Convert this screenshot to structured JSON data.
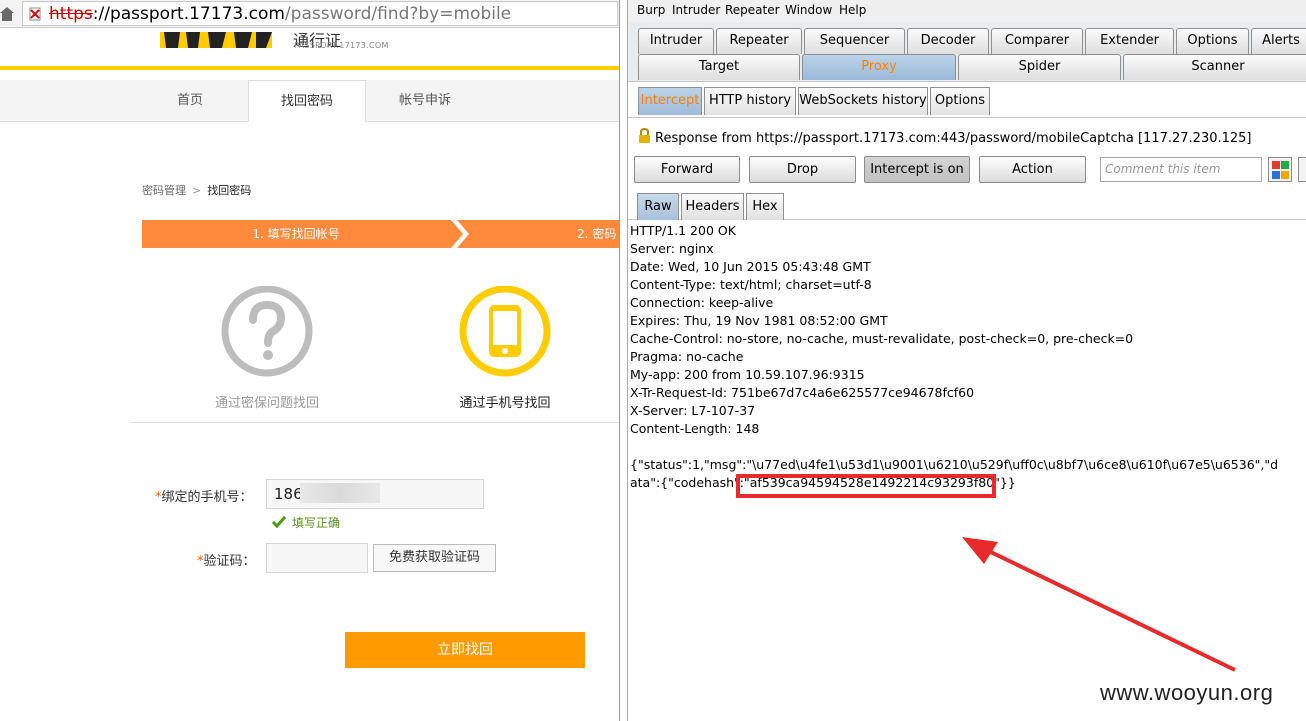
{
  "browser": {
    "url_scheme": "https",
    "url_host": "://passport.17173.com",
    "url_path": "/password/find?by=mobile"
  },
  "site": {
    "logo_title": "通行证",
    "logo_sub": "PASSPORT.17173.COM",
    "nav": [
      "首页",
      "找回密码",
      "帐号申诉"
    ],
    "breadcrumb": {
      "parent": "密码管理",
      "sep": ">",
      "current": "找回密码"
    },
    "steps": [
      "1. 填写找回帐号",
      "2. 密码"
    ],
    "methods": {
      "question": "通过密保问题找回",
      "mobile": "通过手机号找回"
    },
    "form": {
      "phone_label": "绑定的手机号：",
      "phone_value": "186",
      "phone_ok": "填写正确",
      "captcha_label": "验证码：",
      "captcha_button": "免费获取验证码",
      "submit": "立即找回"
    }
  },
  "burp": {
    "menu": [
      "Burp",
      "Intruder",
      "Repeater",
      "Window",
      "Help"
    ],
    "tabs_row1": [
      "Intruder",
      "Repeater",
      "Sequencer",
      "Decoder",
      "Comparer",
      "Extender",
      "Options",
      "Alerts"
    ],
    "tabs_row2": [
      "Target",
      "Proxy",
      "Spider",
      "Scanner"
    ],
    "proxy_tabs": [
      "Intercept",
      "HTTP history",
      "WebSockets history",
      "Options"
    ],
    "response_info": "Response from https://passport.17173.com:443/password/mobileCaptcha   [117.27.230.125]",
    "buttons": {
      "forward": "Forward",
      "drop": "Drop",
      "intercept": "Intercept is on",
      "action": "Action"
    },
    "comment_placeholder": "Comment this item",
    "view_tabs": [
      "Raw",
      "Headers",
      "Hex"
    ],
    "raw_lines": [
      "HTTP/1.1 200 OK",
      "Server: nginx",
      "Date: Wed, 10 Jun 2015 05:43:48 GMT",
      "Content-Type: text/html; charset=utf-8",
      "Connection: keep-alive",
      "Expires: Thu, 19 Nov 1981 08:52:00 GMT",
      "Cache-Control: no-store, no-cache, must-revalidate, post-check=0, pre-check=0",
      "Pragma: no-cache",
      "My-app: 200 from 10.59.107.96:9315",
      "X-Tr-Request-Id: 751be67d7c4a6e625577ce94678fcf60",
      "X-Server: L7-107-37",
      "Content-Length: 148",
      "",
      "{\"status\":1,\"msg\":\"\\u77ed\\u4fe1\\u53d1\\u9001\\u6210\\u529f\\uff0c\\u8bf7\\u6ce8\\u610f\\u67e5\\u6536\",\"d",
      "ata\":{\"codehash\":\"af539ca94594528e1492214c93293f80\"}}"
    ]
  },
  "watermark": "www.wooyun.org",
  "colors": {
    "orange": "#ff8a3c",
    "submit": "#ff9a00",
    "yellow": "#ffcc00",
    "proxy_active": "#ff7d00",
    "highlight": "#e82a2a"
  }
}
